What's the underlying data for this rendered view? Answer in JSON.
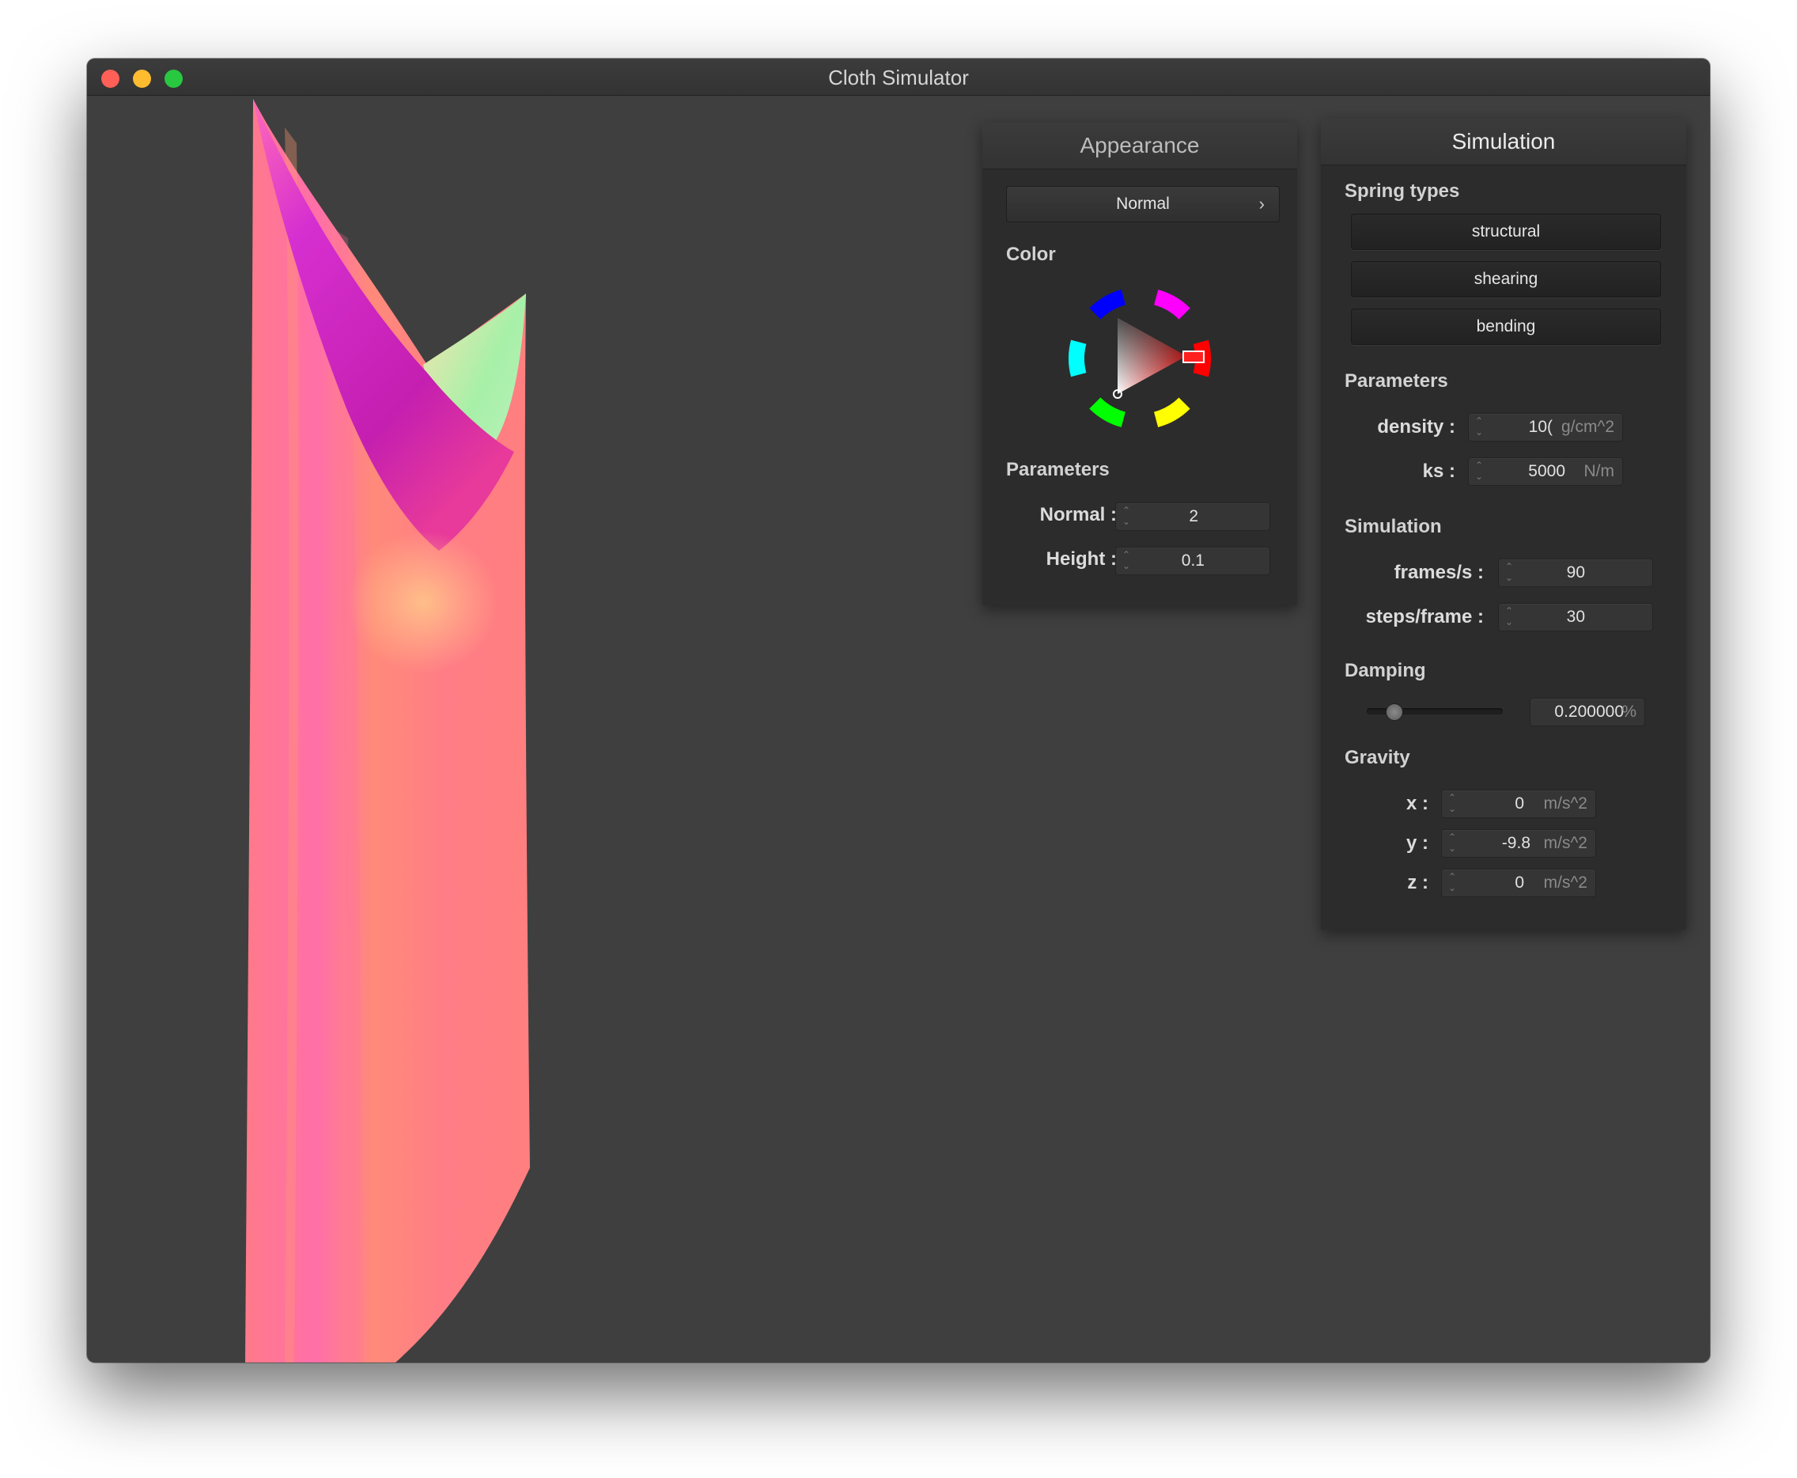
{
  "window": {
    "title": "Cloth Simulator"
  },
  "appearance": {
    "title": "Appearance",
    "shader_dropdown": "Normal",
    "color_label": "Color",
    "color_wheel": {
      "hue_color": "#ff2020"
    },
    "parameters_label": "Parameters",
    "normal_label": "Normal :",
    "normal_value": "2",
    "height_label": "Height :",
    "height_value": "0.1"
  },
  "simulation": {
    "title": "Simulation",
    "spring_types_label": "Spring types",
    "springs": [
      "structural",
      "shearing",
      "bending"
    ],
    "parameters_label": "Parameters",
    "density_label": "density :",
    "density_value": "10(",
    "density_unit": "g/cm^2",
    "ks_label": "ks :",
    "ks_value": "5000",
    "ks_unit": "N/m",
    "sim_label": "Simulation",
    "fps_label": "frames/s :",
    "fps_value": "90",
    "steps_label": "steps/frame :",
    "steps_value": "30",
    "damping_label": "Damping",
    "damping_value": "0.200000",
    "damping_unit": "%",
    "damping_fraction": 0.2,
    "gravity_label": "Gravity",
    "gx_label": "x :",
    "gx_value": "0",
    "gy_label": "y :",
    "gy_value": "-9.8",
    "gz_label": "z :",
    "gz_value": "0",
    "gravity_unit": "m/s^2"
  },
  "colors": {
    "background": "#3f3f3f",
    "cloth_base": "#ff7f7f",
    "cloth_fold": "#c820c8",
    "cloth_highlight": "#9ef0a0"
  }
}
